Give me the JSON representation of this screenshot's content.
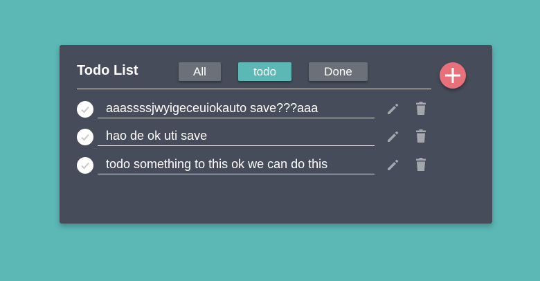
{
  "header": {
    "title": "Todo List",
    "filters": {
      "all": "All",
      "todo": "todo",
      "done": "Done"
    },
    "active_filter": "todo",
    "add_icon": "plus-icon"
  },
  "todos": [
    {
      "text": "aaassssjwyigeceuiokauto save???aaa",
      "done": false
    },
    {
      "text": "hao de ok uti save",
      "done": false
    },
    {
      "text": "todo something to this ok we can do this",
      "done": false
    }
  ],
  "icons": {
    "check": "check-icon",
    "edit": "pencil-icon",
    "delete": "trash-icon"
  },
  "colors": {
    "background": "#5bb8b5",
    "card": "#464c59",
    "accent": "#5bb8b5",
    "add_button": "#e8707a",
    "button": "#6b7079",
    "icon": "#a3a6ad"
  }
}
